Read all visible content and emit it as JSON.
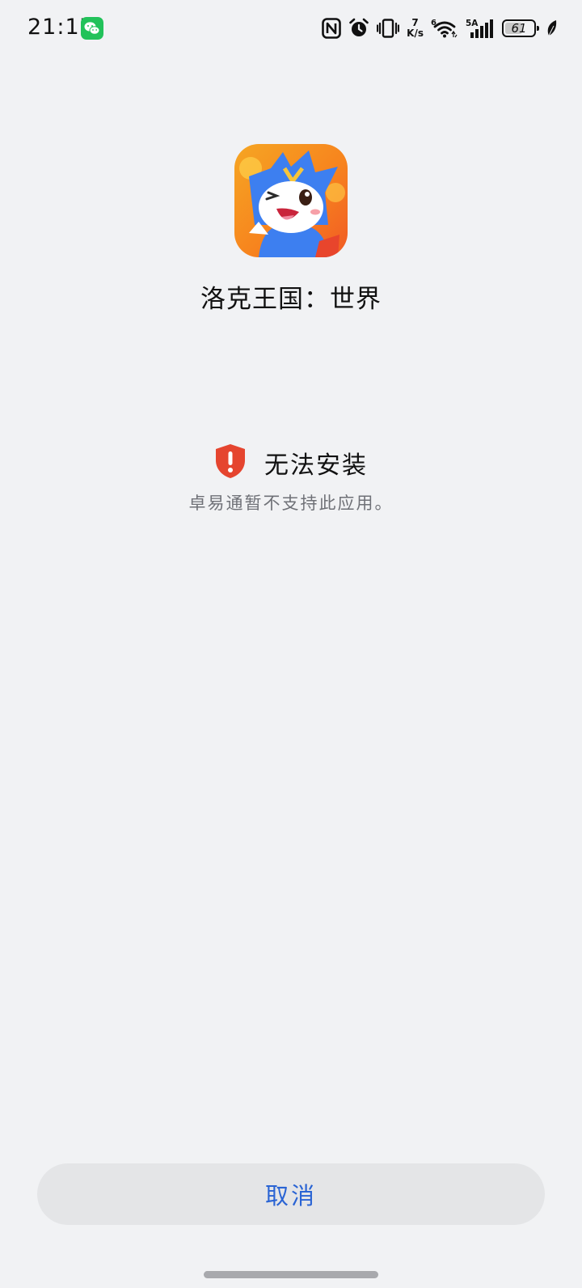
{
  "status_bar": {
    "time": "21:17",
    "net_speed_value": "7",
    "net_speed_unit": "K/s",
    "battery_level": 61,
    "battery_text": "61",
    "icons": [
      "wechat-icon",
      "nfc-icon",
      "alarm-icon",
      "vibrate-icon",
      "wifi-icon",
      "signal-icon",
      "battery-icon",
      "leaf-icon"
    ]
  },
  "app": {
    "name": "洛克王国：世界"
  },
  "error": {
    "title": "无法安装",
    "description": "卓易通暂不支持此应用。",
    "icon": "shield-alert-icon",
    "icon_color": "#e5452f"
  },
  "actions": {
    "cancel_label": "取消",
    "accent_color": "#2a64d4"
  }
}
